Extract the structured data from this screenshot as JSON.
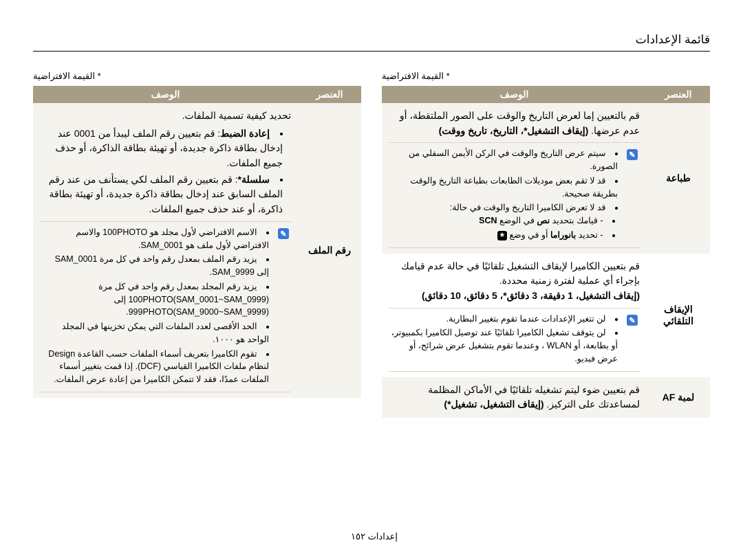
{
  "page_title": "قائمة الإعدادات",
  "default_note": "* القيمة الافتراضية",
  "headers": {
    "item": "العنصر",
    "desc": "الوصف"
  },
  "right": {
    "row1": {
      "item": "رقم الملف",
      "intro": "تحديد كيفية تسمية الملفات.",
      "b_reset_label": "إعادة الضبط",
      "b_reset_text": ": قم بتعيين رقم الملف ليبدأ من 0001 عند إدخال بطاقة ذاكرة جديدة، أو تهيئة بطاقة الذاكرة، أو حذف جميع الملفات.",
      "b_series_label": "سلسلة*",
      "b_series_text": ": قم بتعيين رقم الملف لكي يستأنف من عند رقم الملف السابق عند إدخال بطاقة ذاكرة جديدة، أو تهيئة بطاقة ذاكرة، أو عند حذف جميع الملفات.",
      "tip1": "الاسم الافتراضي لأول مجلد هو 100PHOTO والاسم الافتراضي لأول ملف هو SAM_0001.",
      "tip2": "يزيد رقم الملف بمعدل رقم واحد في كل مرة SAM_0001 إلى SAM_9999.",
      "tip3": "يزيد رقم المجلد بمعدل رقم واحد في كل مرة 100PHOTO(SAM_0001~SAM_0999) إلى 999PHOTO(SAM_9000~SAM_9999).",
      "tip4": "الحد الأقصى لعدد الملفات التي يمكن تخزينها في المجلد الواحد هو ١٠٠٠.",
      "tip5": "تقوم الكاميرا بتعريف أسماء الملفات حسب القاعدة Design لنظام ملفات الكاميرا القياسي (DCF). إذا قمت بتغيير أسماء الملفات عمدًا، فقد لا تتمكن الكاميرا من إعادة عرض الملفات."
    }
  },
  "left": {
    "row1": {
      "item": "طباعة",
      "l1": "قم بالتعيين إما لعرض التاريخ والوقت على الصور الملتقطة، أو عدم عرضها. ",
      "opts": "(إيقاف التشغيل*، التاريخ، تاريخ ووقت)",
      "tip1": "سيتم عرض التاريخ والوقت في الركن الأيمن السفلي من الصورة.",
      "tip2": "قد لا تقم بعض موديلات الطابعات بطباعة التاريخ والوقت بطريقة صحيحة.",
      "tip3": "قد لا تعرض الكاميرا التاريخ والوقت في حالة:",
      "dash_a_pre": "قيامك بتحديد ",
      "dash_a_bold": "نص",
      "dash_a_mid": " في الوضع ",
      "dash_a_scn": "SCN",
      "dash_b_pre": "تحديد ",
      "dash_b_bold": "بانوراما",
      "dash_b_suf": " أو في وضع "
    },
    "row2": {
      "item": "الإيقاف التلقائي",
      "l1": "قم بتعيين الكاميرا لإيقاف التشغيل تلقائيًا في حالة عدم قيامك بإجراء أي عملية لفترة زمنية محددة.",
      "opts": "(إيقاف التشغيل، 1 دقيقة، 3 دقائق*، 5 دقائق، 10 دقائق)",
      "tip1": "لن تتغير الإعدادات عندما تقوم بتغيير البطارية.",
      "tip2": "لن يتوقف تشغيل الكاميرا تلقائيًا عند توصيل الكاميرا بكمبيوتر، أو بطابعة، أو WLAN ، وعندما تقوم بتشغيل عرض شرائح، أو عرض فيديو."
    },
    "row3": {
      "item": "لمبة AF",
      "l1": "قم بتعيين ضوء ليتم تشغيله تلقائيًا في الأماكن المظلمة لمساعدتك على التركيز. ",
      "opts": "(إيقاف التشغيل، تشغيل*)"
    }
  },
  "footer": {
    "pn": "١٥٢",
    "label": "إعدادات"
  }
}
